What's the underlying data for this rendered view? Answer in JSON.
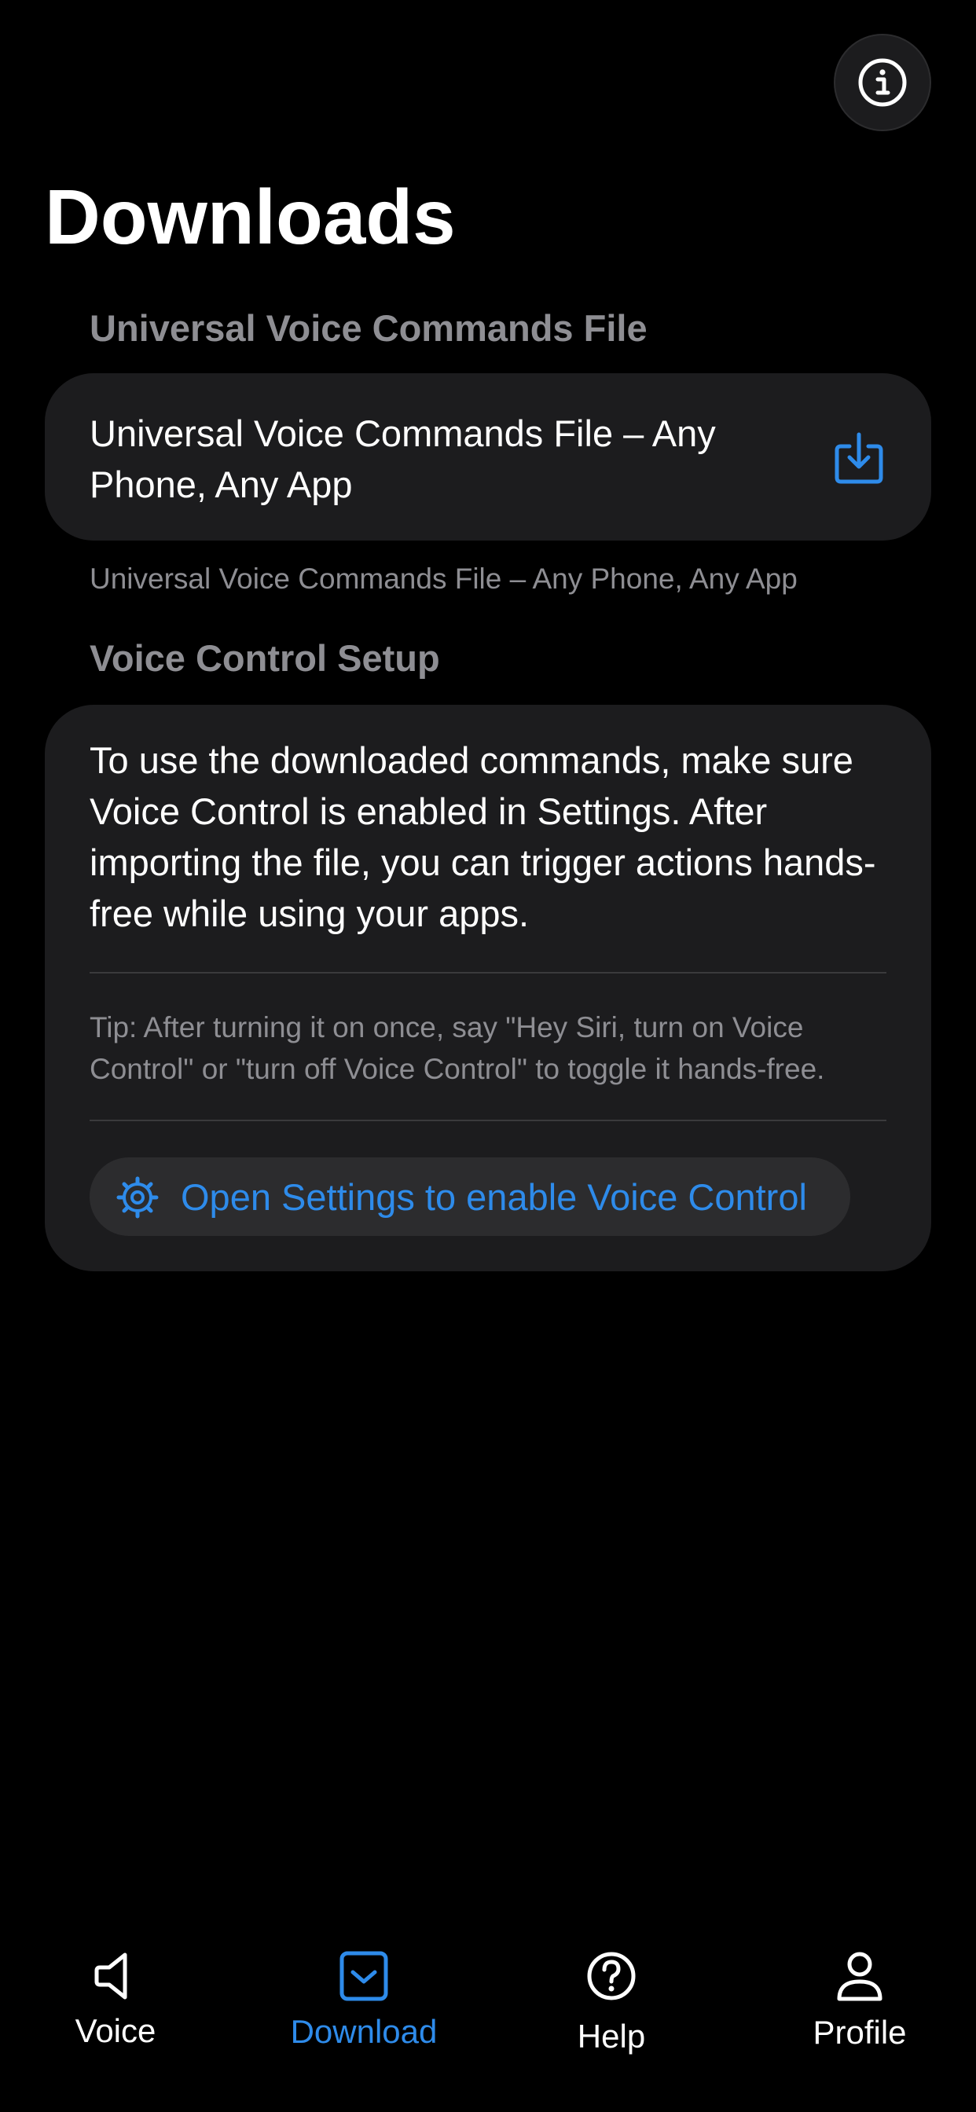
{
  "header": {
    "title": "Downloads"
  },
  "sections": {
    "commands_file": {
      "header": "Universal Voice Commands File",
      "item_title": "Universal Voice Commands File – Any Phone, Any App",
      "footer": "Universal Voice Commands File – Any Phone, Any App"
    },
    "setup": {
      "header": "Voice Control Setup",
      "body": "To use the downloaded commands, make sure Voice Control is enabled in Settings. After importing the file, you can trigger actions hands-free while using your apps.",
      "tip": "Tip: After turning it on once, say \"Hey Siri, turn on Voice Control\" or \"turn off Voice Control\" to toggle it hands-free.",
      "button_label": "Open Settings to enable Voice Control"
    }
  },
  "tab_bar": {
    "tabs": [
      {
        "label": "Voice",
        "icon": "speaker-icon",
        "active": false
      },
      {
        "label": "Download",
        "icon": "download-tray-icon",
        "active": true
      },
      {
        "label": "Help",
        "icon": "question-circle-icon",
        "active": false
      },
      {
        "label": "Profile",
        "icon": "person-icon",
        "active": false
      }
    ]
  },
  "colors": {
    "background": "#000000",
    "card": "#1c1c1e",
    "accent": "#2e8bea",
    "secondary_text": "#8e8e93"
  },
  "icons": {
    "info": "info-circle-icon",
    "download": "download-icon",
    "settings": "gear-icon"
  }
}
